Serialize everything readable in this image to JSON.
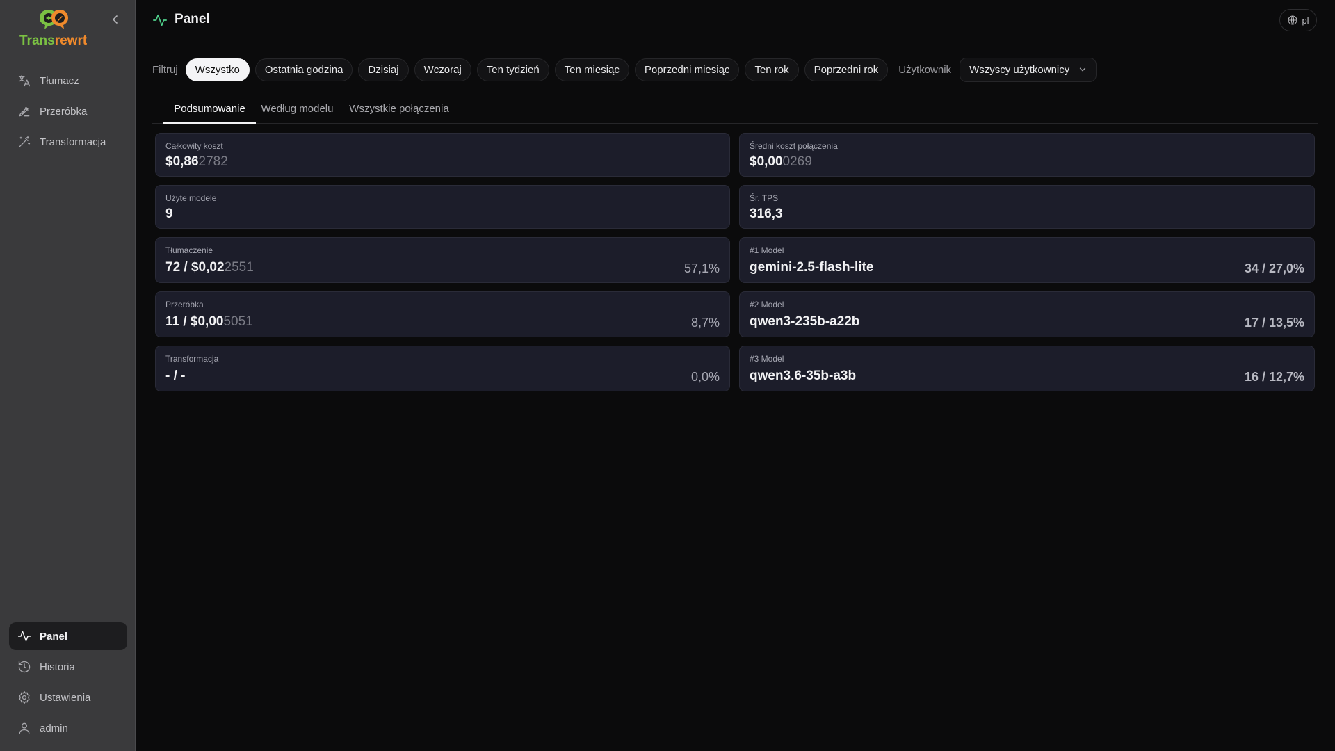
{
  "app": {
    "logo_text_part1": "Trans",
    "logo_text_part2": "rewrt",
    "brand_colors": {
      "green": "#7bc143",
      "orange": "#f08a2c"
    }
  },
  "sidebar": {
    "top_items": [
      {
        "label": "Tłumacz",
        "icon": "translate-icon"
      },
      {
        "label": "Przeróbka",
        "icon": "pen-icon"
      },
      {
        "label": "Transformacja",
        "icon": "wand-icon"
      }
    ],
    "bottom_items": [
      {
        "label": "Panel",
        "icon": "activity-icon",
        "active": true
      },
      {
        "label": "Historia",
        "icon": "history-icon"
      },
      {
        "label": "Ustawienia",
        "icon": "gear-icon"
      },
      {
        "label": "admin",
        "icon": "user-icon"
      }
    ]
  },
  "header": {
    "title": "Panel",
    "language": "pl"
  },
  "filters": {
    "label": "Filtruj",
    "options": [
      "Wszystko",
      "Ostatnia godzina",
      "Dzisiaj",
      "Wczoraj",
      "Ten tydzień",
      "Ten miesiąc",
      "Poprzedni miesiąc",
      "Ten rok",
      "Poprzedni rok"
    ],
    "selected": "Wszystko",
    "user_label": "Użytkownik",
    "user_selected": "Wszyscy użytkownicy"
  },
  "tabs": [
    "Podsumowanie",
    "Według modelu",
    "Wszystkie połączenia"
  ],
  "active_tab": "Podsumowanie",
  "cards": {
    "total_cost": {
      "label": "Całkowity koszt",
      "value_main": "$0,86",
      "value_dim": "2782"
    },
    "avg_cost": {
      "label": "Średni koszt połączenia",
      "value_main": "$0,00",
      "value_dim": "0269"
    },
    "models_used": {
      "label": "Użyte modele",
      "value": "9"
    },
    "avg_tps": {
      "label": "Śr. TPS",
      "value": "316,3"
    },
    "translation": {
      "label": "Tłumaczenie",
      "value_main": "72 / $0,02",
      "value_dim": "2551",
      "pct": "57,1%"
    },
    "rewrite": {
      "label": "Przeróbka",
      "value_main": "11 / $0,00",
      "value_dim": "5051",
      "pct": "8,7%"
    },
    "transform": {
      "label": "Transformacja",
      "value_main": "- / -",
      "pct": "0,0%"
    },
    "model1": {
      "label": "#1 Model",
      "value": "gemini-2.5-flash-lite",
      "stat": "34 / 27,0%"
    },
    "model2": {
      "label": "#2 Model",
      "value": "qwen3-235b-a22b",
      "stat": "17 / 13,5%"
    },
    "model3": {
      "label": "#3 Model",
      "value": "qwen3.6-35b-a3b",
      "stat": "16 / 12,7%"
    }
  }
}
